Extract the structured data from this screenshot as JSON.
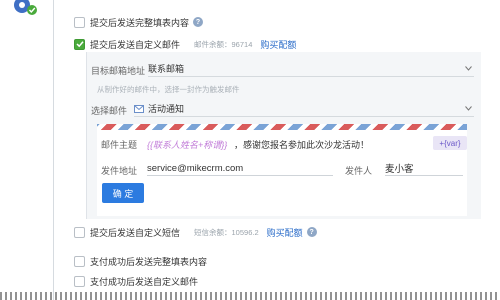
{
  "options": [
    {
      "label": "提交后发送完整填表内容",
      "checked": false,
      "has_help": true
    },
    {
      "label": "提交后发送自定义邮件",
      "checked": true,
      "quota": "邮件余额：96714",
      "buy_link": "购买配额"
    },
    {
      "label": "提交后发送自定义短信",
      "checked": false,
      "quota": "短信余额：10596.2",
      "buy_link": "购买配额",
      "has_help": true
    },
    {
      "label": "支付成功后发送完整填表内容",
      "checked": false
    },
    {
      "label": "支付成功后发送自定义邮件",
      "checked": false
    }
  ],
  "help_glyph": "?",
  "mail_settings": {
    "target_label": "目标邮箱地址",
    "target_value": "联系邮箱",
    "hint": "从制作好的邮件中，选择一封作为触发邮件",
    "choose_label": "选择邮件",
    "choose_value": "活动通知"
  },
  "envelope": {
    "subject_label": "邮件主题",
    "subject_var": "{{联系人姓名+称谓}}",
    "subject_text": "，感谢您报名参加此次沙龙活动！",
    "var_button": "+{var}",
    "from_label": "发件地址",
    "from_value": "service@mikecrm.com",
    "sender_label": "发件人",
    "sender_value": "麦小客",
    "confirm_label": "确 定"
  },
  "colors": {
    "accent": "#2c7be0",
    "check": "#4aaa3c",
    "link": "#2a6cc9",
    "stripe_blue": "#7aa3d6",
    "stripe_red": "#d95b5b"
  }
}
